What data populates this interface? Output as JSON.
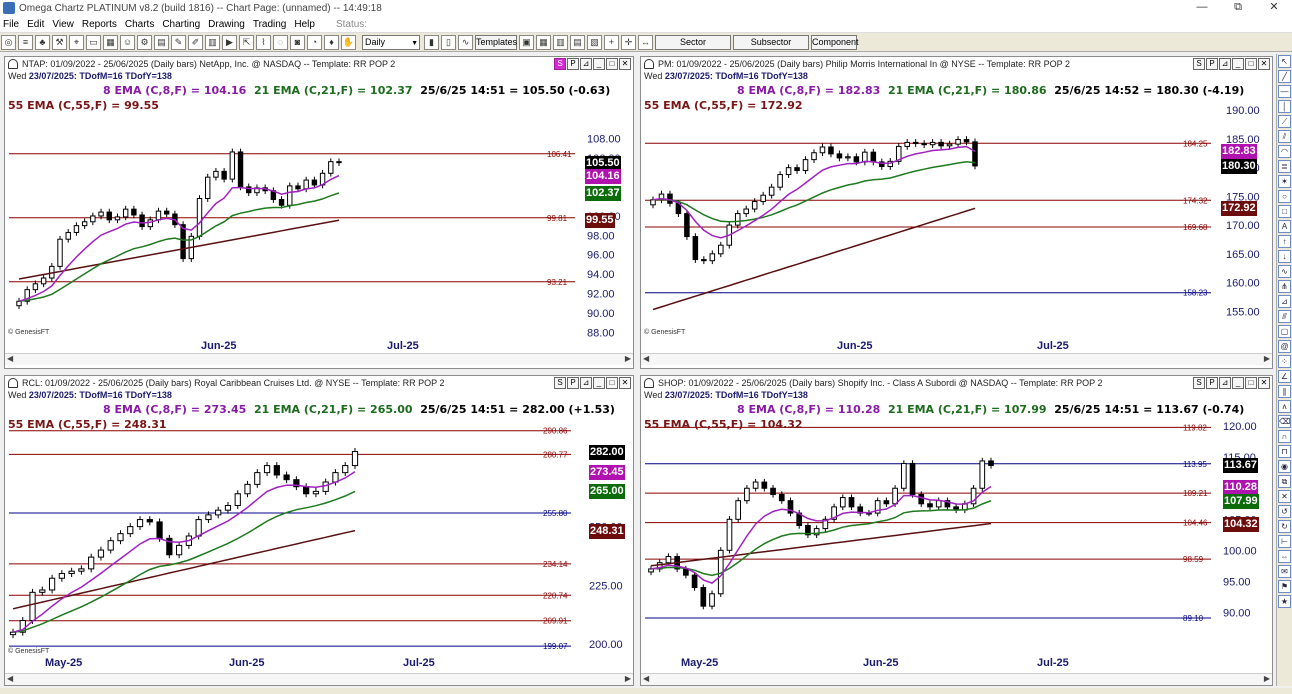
{
  "app": {
    "title": "Omega Chartz PLATINUM v8.2 (build 1816)  --  Chart Page: (unnamed)  --  14:49:18"
  },
  "window_buttons": [
    "—",
    "⧉",
    "✕"
  ],
  "menu": {
    "items": [
      "File",
      "Edit",
      "View",
      "Reports",
      "Charts",
      "Charting",
      "Drawing",
      "Trading",
      "Help"
    ],
    "status": "Status:"
  },
  "toolbar": {
    "period": "Daily",
    "templates": "Templates",
    "sector": "Sector",
    "subsector": "Subsector",
    "component": "Component"
  },
  "panes": [
    {
      "title": "NTAP:  01/09/2022 - 25/06/2025  (Daily bars)   NetApp, Inc. @ NASDAQ  --  Template: RR POP 2",
      "date_line_day": "Wed",
      "date_line_rest": "23/07/2025:  TDofM=16  TDofY=138",
      "ema8": "8 EMA (C,8,F) = 104.16",
      "ema21": "21 EMA (C,21,F) = 102.37",
      "last": "25/6/25 14:51 = 105.50 (-0.63)",
      "ema55": "55 EMA (C,55,F) = 99.55",
      "y_ticks": [
        "108.00",
        "106.00",
        "104.00",
        "102.00",
        "100.00",
        "98.00",
        "96.00",
        "94.00",
        "92.00",
        "90.00",
        "88.00"
      ],
      "x_ticks": [
        "Jun-25",
        "Jul-25"
      ],
      "levels": [
        "106.41",
        "99.81",
        "93.21"
      ],
      "tags": {
        "last": "105.50",
        "ema8": "104.16",
        "ema21": "102.37",
        "ema55": "99.55"
      },
      "copyright": "© GenesisFT",
      "header_buttons": [
        "S",
        "P",
        "⊿",
        "_",
        "□",
        "✕"
      ]
    },
    {
      "title": "PM:  01/09/2022 - 25/06/2025  (Daily bars)   Philip Morris International In @ NYSE  --  Template: RR POP 2",
      "date_line_day": "Wed",
      "date_line_rest": "23/07/2025:  TDofM=16  TDofY=138",
      "ema8": "8 EMA (C,8,F) = 182.83",
      "ema21": "21 EMA (C,21,F) = 180.86",
      "last": "25/6/25 14:52 = 180.30 (-4.19)",
      "ema55": "55 EMA (C,55,F) = 172.92",
      "y_ticks": [
        "190.00",
        "185.00",
        "180.00",
        "175.00",
        "170.00",
        "165.00",
        "160.00",
        "155.00"
      ],
      "x_ticks": [
        "Jun-25",
        "Jul-25"
      ],
      "levels": [
        "184.25",
        "174.32",
        "169.68",
        "158.23"
      ],
      "tags": {
        "ema8": "182.83",
        "last": "180.30",
        "ema55": "172.92"
      },
      "copyright": "© GenesisFT",
      "header_buttons": [
        "S",
        "P",
        "⊿",
        "_",
        "□",
        "✕"
      ]
    },
    {
      "title": "RCL:  01/09/2022 - 25/06/2025  (Daily bars)   Royal Caribbean Cruises Ltd. @ NYSE  --  Template: RR POP 2",
      "date_line_day": "Wed",
      "date_line_rest": "23/07/2025:  TDofM=16  TDofY=138",
      "ema8": "8 EMA (C,8,F) = 273.45",
      "ema21": "21 EMA (C,21,F) = 265.00",
      "last": "25/6/25 14:51 = 282.00 (+1.53)",
      "ema55": "55 EMA (C,55,F) = 248.31",
      "y_ticks": [
        "250.00",
        "225.00",
        "200.00"
      ],
      "x_ticks": [
        "May-25",
        "Jun-25",
        "Jul-25"
      ],
      "levels": [
        "290.86",
        "280.77",
        "255.80",
        "234.14",
        "220.74",
        "209.91",
        "199.07"
      ],
      "tags": {
        "last": "282.00",
        "ema8": "273.45",
        "ema21": "265.00",
        "ema55": "248.31"
      },
      "copyright": "© GenesisFT",
      "header_buttons": [
        "S",
        "P",
        "⊿",
        "_",
        "□",
        "✕"
      ]
    },
    {
      "title": "SHOP:  01/09/2022 - 25/06/2025  (Daily bars)   Shopify Inc. - Class A Subordi @ NASDAQ  --  Template: RR POP 2",
      "date_line_day": "Wed",
      "date_line_rest": "23/07/2025:  TDofM=16  TDofY=138",
      "ema8": "8 EMA (C,8,F) = 110.28",
      "ema21": "21 EMA (C,21,F) = 107.99",
      "last": "25/6/25 14:51 = 113.67 (-0.74)",
      "ema55": "55 EMA (C,55,F) = 104.32",
      "y_ticks": [
        "120.00",
        "115.00",
        "110.00",
        "105.00",
        "100.00",
        "95.00",
        "90.00"
      ],
      "x_ticks": [
        "May-25",
        "Jun-25",
        "Jul-25"
      ],
      "levels": [
        "119.82",
        "113.95",
        "109.21",
        "104.46",
        "98.59",
        "89.10"
      ],
      "tags": {
        "last": "113.67",
        "ema8": "110.28",
        "ema21": "107.99",
        "ema55": "104.32"
      },
      "copyright": "© GenesisFT",
      "header_buttons": [
        "S",
        "P",
        "⊿",
        "_",
        "□",
        "✕"
      ]
    }
  ],
  "chart_data": [
    {
      "type": "candlestick",
      "symbol": "NTAP",
      "ylim": [
        87,
        110
      ],
      "y_ticks": [
        108,
        106,
        104,
        102,
        100,
        98,
        96,
        94,
        92,
        90,
        88
      ],
      "levels": [
        106.41,
        99.81,
        93.21
      ],
      "closes": [
        91.2,
        92.4,
        93.0,
        93.6,
        94.8,
        97.6,
        98.3,
        99.0,
        99.4,
        100.0,
        100.4,
        99.6,
        99.9,
        100.7,
        100.1,
        98.9,
        99.6,
        100.5,
        100.2,
        99.1,
        95.6,
        97.9,
        101.8,
        104.0,
        104.6,
        103.8,
        106.6,
        103.0,
        102.4,
        102.9,
        102.6,
        101.7,
        101.1,
        103.1,
        102.8,
        103.7,
        103.2,
        104.4,
        105.6,
        105.5
      ],
      "ema8_last": 104.16,
      "ema21_last": 102.37,
      "ema55_last": 99.55,
      "ema55_first": 93.5
    },
    {
      "type": "candlestick",
      "symbol": "PM",
      "ylim": [
        154,
        193
      ],
      "y_ticks": [
        190,
        185,
        180,
        175,
        170,
        165,
        160,
        155
      ],
      "levels": [
        184.25,
        174.32,
        169.68,
        158.23
      ],
      "closes": [
        174.4,
        175.4,
        173.8,
        172.0,
        168.0,
        164.0,
        163.8,
        165.0,
        166.5,
        170.0,
        172.0,
        172.8,
        174.1,
        175.2,
        176.6,
        178.8,
        180.0,
        179.5,
        181.4,
        182.6,
        183.6,
        182.4,
        181.7,
        181.9,
        181.0,
        182.7,
        181.0,
        180.2,
        181.1,
        183.7,
        184.4,
        184.2,
        184.0,
        184.4,
        183.8,
        184.1,
        184.9,
        184.49,
        180.3
      ],
      "ema8_last": 182.83,
      "ema21_last": 180.86,
      "ema55_last": 172.92,
      "ema55_first": 155.3
    },
    {
      "type": "candlestick",
      "symbol": "RCL",
      "ylim": [
        197,
        295
      ],
      "y_ticks": [
        250,
        225,
        200
      ],
      "levels": [
        290.86,
        280.77,
        255.8,
        234.14,
        220.74,
        209.91,
        199.07
      ],
      "closes": [
        205,
        210,
        222,
        223,
        228,
        230,
        231,
        232,
        237,
        240,
        244,
        247,
        250,
        253,
        252,
        245,
        238,
        242,
        246,
        253,
        255,
        257,
        259,
        264,
        268,
        273,
        276,
        272,
        270,
        267,
        264,
        265,
        269,
        273,
        276,
        282.0
      ],
      "ema8_last": 273.45,
      "ema21_last": 265.0,
      "ema55_last": 248.31,
      "ema55_first": 215
    },
    {
      "type": "candlestick",
      "symbol": "SHOP",
      "ylim": [
        87,
        121
      ],
      "y_ticks": [
        120,
        115,
        110,
        105,
        100,
        95,
        90
      ],
      "levels": [
        119.82,
        113.95,
        109.21,
        104.46,
        98.59,
        89.1
      ],
      "closes": [
        97.0,
        98.0,
        99.0,
        97.0,
        96.0,
        94.0,
        91.0,
        93.0,
        100.0,
        105.0,
        108.0,
        110.0,
        111.0,
        110.0,
        109.0,
        108.0,
        106.0,
        104.0,
        102.5,
        103.5,
        105.0,
        107.0,
        108.5,
        107.0,
        106.0,
        106.0,
        108.0,
        107.5,
        110.0,
        114.0,
        109.0,
        107.5,
        107.0,
        108.0,
        107.0,
        106.5,
        107.5,
        110.0,
        114.4,
        113.67
      ],
      "ema8_last": 110.28,
      "ema21_last": 107.99,
      "ema55_last": 104.32,
      "ema55_first": 97.5
    }
  ]
}
